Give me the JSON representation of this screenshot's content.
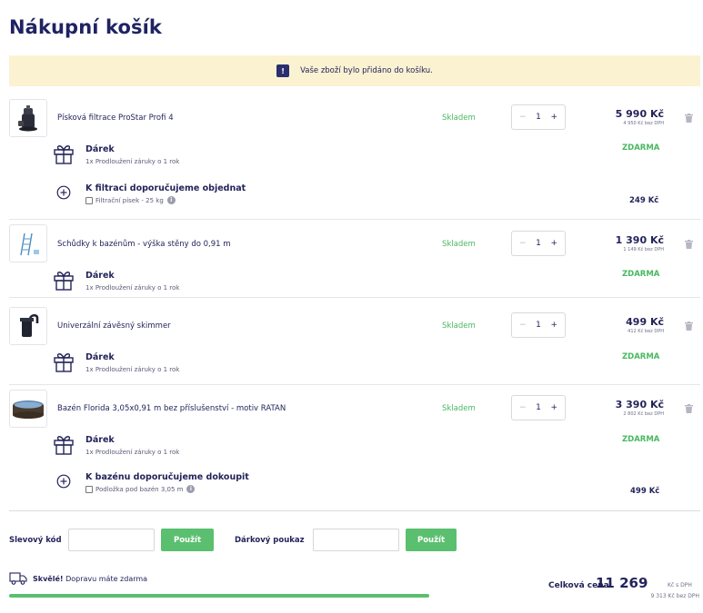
{
  "title": "Nákupní košík",
  "notice": {
    "badge": "!",
    "text": "Vaše zboží bylo přidáno do košíku."
  },
  "items": [
    {
      "name": "Písková filtrace ProStar Profi 4",
      "stock": "Skladem",
      "qty": "1",
      "price": "5 990 Kč",
      "price_net": "4 950 Kč bez DPH",
      "gift": {
        "title": "Dárek",
        "desc": "1x Prodloužení záruky o 1 rok",
        "price": "ZDARMA"
      },
      "reco": {
        "title": "K filtraci doporučujeme objednat",
        "option": "Filtrační písek - 25 kg",
        "price": "249 Kč"
      }
    },
    {
      "name": "Schůdky k bazénům - výška stěny do 0,91 m",
      "stock": "Skladem",
      "qty": "1",
      "price": "1 390 Kč",
      "price_net": "1 149 Kč bez DPH",
      "gift": {
        "title": "Dárek",
        "desc": "1x Prodloužení záruky o 1 rok",
        "price": "ZDARMA"
      }
    },
    {
      "name": "Univerzální závěsný skimmer",
      "stock": "Skladem",
      "qty": "1",
      "price": "499 Kč",
      "price_net": "412 Kč bez DPH",
      "gift": {
        "title": "Dárek",
        "desc": "1x Prodloužení záruky o 1 rok",
        "price": "ZDARMA"
      }
    },
    {
      "name": "Bazén Florida 3,05x0,91 m bez příslušenství - motiv RATAN",
      "stock": "Skladem",
      "qty": "1",
      "price": "3 390 Kč",
      "price_net": "2 802 Kč bez DPH",
      "gift": {
        "title": "Dárek",
        "desc": "1x Prodloužení záruky o 1 rok",
        "price": "ZDARMA"
      },
      "reco": {
        "title": "K bazénu doporučujeme dokoupit",
        "option": "Podložka pod bazén 3,05 m",
        "price": "499 Kč"
      }
    }
  ],
  "qty_controls": {
    "minus": "−",
    "plus": "+"
  },
  "discount": {
    "label": "Slevový kód",
    "placeholder": "",
    "button": "Použít"
  },
  "voucher": {
    "label": "Dárkový poukaz",
    "placeholder": "",
    "button": "Použít"
  },
  "shipping": {
    "bold": "Skvělé!",
    "text": " Dopravu máte zdarma",
    "progress_percent": 100
  },
  "total": {
    "label": "Celková cena:",
    "value": "11 269",
    "suffix": "Kč s DPH",
    "net": "9 313 Kč bez DPH"
  },
  "colors": {
    "accent_green": "#5bbf70",
    "stock_green": "#49b860",
    "navy": "#23245a",
    "notice_bg": "#fbf2d2"
  },
  "icons": [
    "gift-icon",
    "plus-circle-icon",
    "trash-icon",
    "truck-icon",
    "info-icon"
  ]
}
